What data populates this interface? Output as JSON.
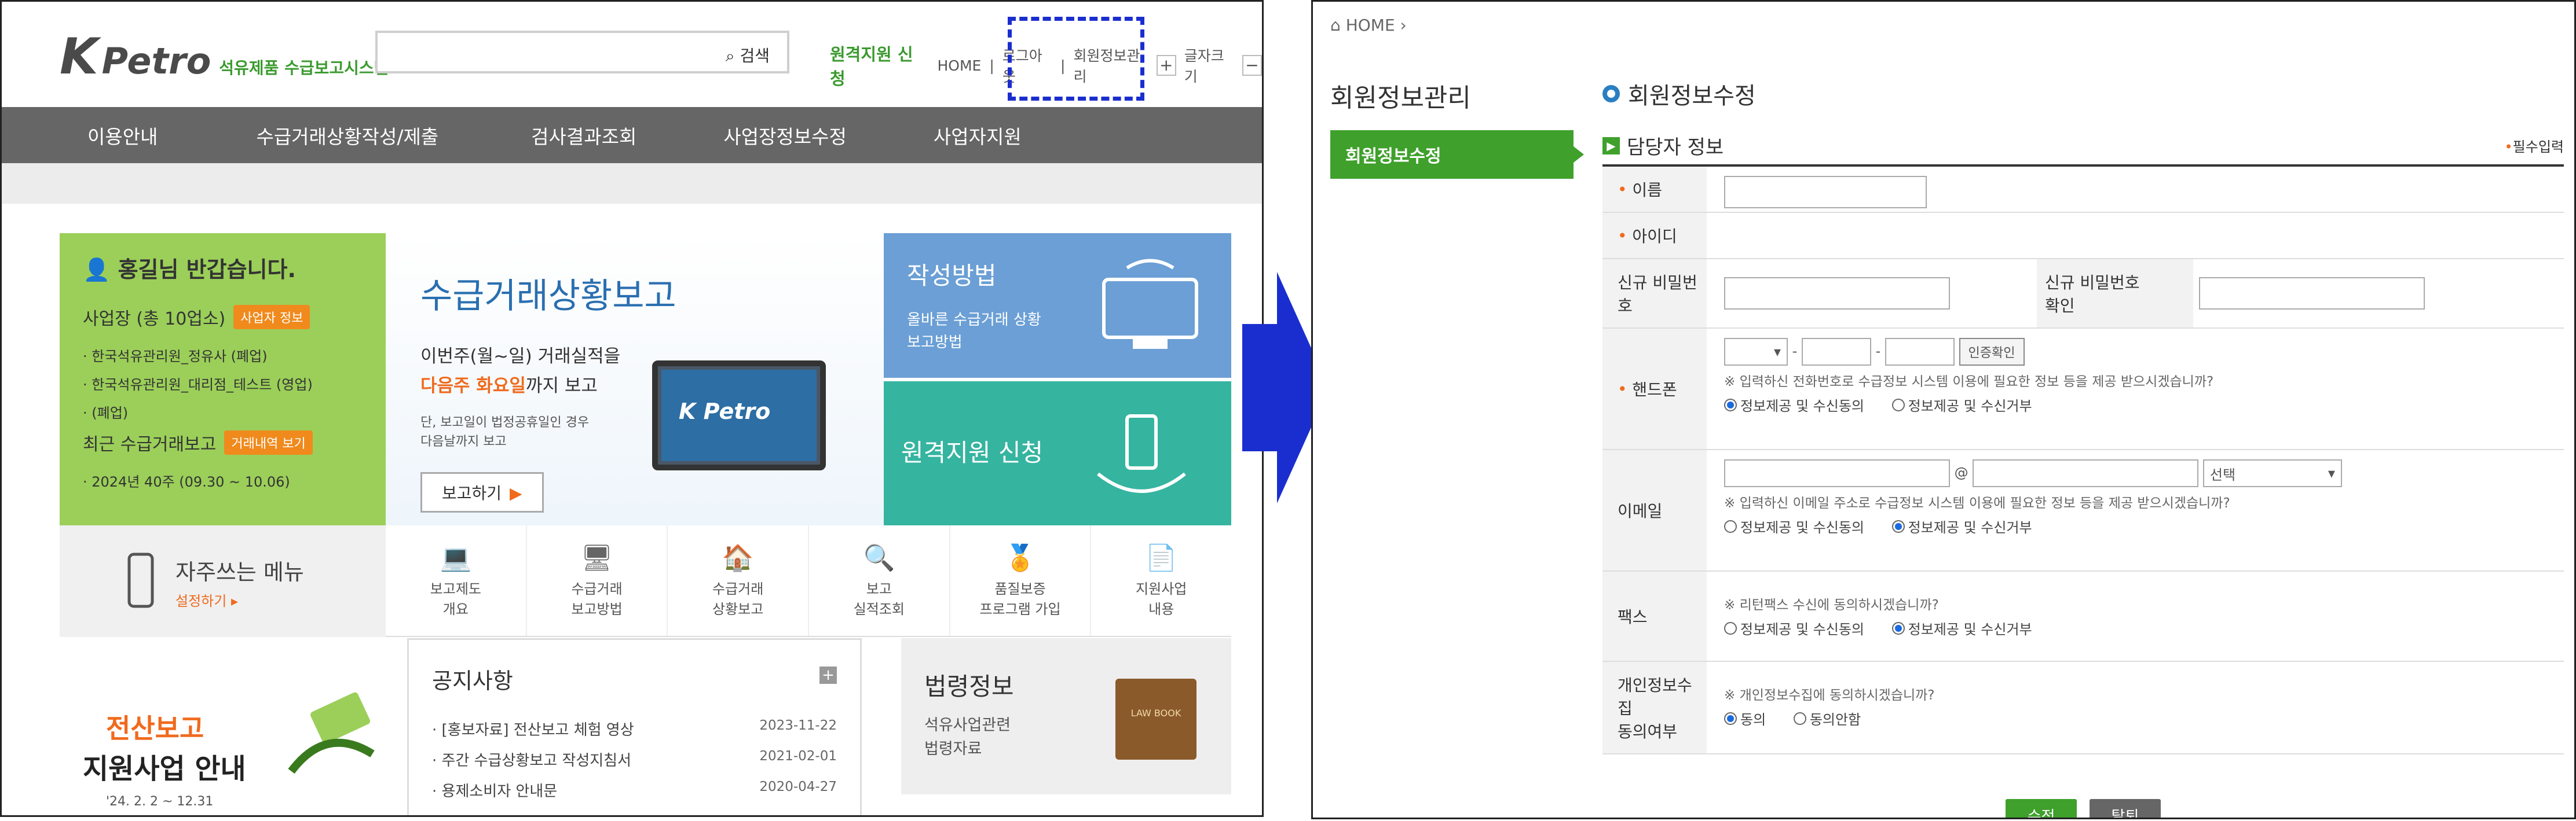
{
  "left": {
    "logo": {
      "brand_k": "K",
      "brand_petro": "Petro",
      "subtitle": "석유제품 수급보고시스템"
    },
    "search": {
      "button": "검색"
    },
    "toplinks": {
      "remote": "원격지원 신청",
      "home": "HOME",
      "logout": "로그아웃",
      "member": "회원정보관리",
      "plus": "+",
      "fontsize": "글자크기",
      "minus": "−"
    },
    "nav": [
      "이용안내",
      "수급거래상황작성/제출",
      "검사결과조회",
      "사업장정보수정",
      "사업자지원"
    ],
    "welcome": {
      "greeting": "홍길님 반갑습니다.",
      "sites": "사업장 (총 10업소)",
      "sites_tag": "사업자 정보",
      "items": [
        "· 한국석유관리원_정유사 (폐업)",
        "· 한국석유관리원_대리점_테스트 (영업)",
        "· (폐업)"
      ],
      "recent": "최근 수급거래보고",
      "recent_tag": "거래내역 보기",
      "period": "· 2024년 40주 (09.30 ~ 10.06)"
    },
    "banner": {
      "title": "수급거래상황보고",
      "line1": "이번주(월~일) 거래실적을",
      "line2_hl": "다음주 화요일",
      "line2_rest": "까지 보고",
      "line3a": "단, 보고일이 법정공휴일인 경우",
      "line3b": "다음날까지 보고",
      "button": "보고하기",
      "screen": "K Petro"
    },
    "how": {
      "title": "작성방법",
      "line1": "올바른 수급거래 상황",
      "line2": "보고방법"
    },
    "remote": {
      "title": "원격지원 신청"
    },
    "quick": {
      "title": "자주쓰는 메뉴",
      "setting": "설정하기"
    },
    "quick_icons": [
      {
        "icon": "laptop-icon",
        "l1": "보고제도",
        "l2": "개요"
      },
      {
        "icon": "monitor-edit-icon",
        "l1": "수급거래",
        "l2": "보고방법"
      },
      {
        "icon": "house-doc-icon",
        "l1": "수급거래",
        "l2": "상황보고"
      },
      {
        "icon": "magnifier-icon",
        "l1": "보고",
        "l2": "실적조회"
      },
      {
        "icon": "medal-icon",
        "l1": "품질보증",
        "l2": "프로그램 가입"
      },
      {
        "icon": "document-icon",
        "l1": "지원사업",
        "l2": "내용"
      }
    ],
    "support": {
      "a": "전산보고",
      "b": "지원사업 안내",
      "c": "'24. 2. 2 ~ 12.31"
    },
    "notice": {
      "title": "공지사항",
      "items": [
        {
          "t": "· [홍보자료] 전산보고 체험 영상",
          "d": "2023-11-22"
        },
        {
          "t": "· 주간 수급상황보고 작성지침서",
          "d": "2021-02-01"
        },
        {
          "t": "· 용제소비자 안내문",
          "d": "2020-04-27"
        }
      ]
    },
    "law": {
      "title": "법령정보",
      "l1": "석유사업관련",
      "l2": "법령자료",
      "book": "LAW BOOK"
    }
  },
  "right": {
    "home": "HOME",
    "title": "회원정보관리",
    "menu": "회원정보수정",
    "form_title": "회원정보수정",
    "section": "담당자 정보",
    "required": "필수입력",
    "labels": {
      "name": "이름",
      "id": "아이디",
      "newpw": "신규 비밀번호",
      "newpw2a": "신규 비밀번호",
      "newpw2b": "확인",
      "phone": "핸드폰",
      "email": "이메일",
      "fax": "팩스",
      "privacy_a": "개인정보수집",
      "privacy_b": "동의여부"
    },
    "phone": {
      "verify": "인증확인",
      "dash": "-",
      "note": "※ 입력하신 전화번호로 수급정보 시스템 이용에 필요한 정보 등을 제공 받으시겠습니까?",
      "opt_yes": "정보제공 및 수신동의",
      "opt_no": "정보제공 및 수신거부"
    },
    "email": {
      "at": "@",
      "select": "선택",
      "note": "※ 입력하신 이메일 주소로 수급정보 시스템 이용에 필요한 정보 등을 제공 받으시겠습니까?",
      "opt_yes": "정보제공 및 수신동의",
      "opt_no": "정보제공 및 수신거부"
    },
    "fax": {
      "note": "※ 리턴팩스 수신에 동의하시겠습니까?",
      "opt_yes": "정보제공 및 수신동의",
      "opt_no": "정보제공 및 수신거부"
    },
    "privacy": {
      "note": "※ 개인정보수집에 동의하시겠습니까?",
      "opt_yes": "동의",
      "opt_no": "동의안함"
    },
    "buttons": {
      "save": "수정",
      "withdraw": "탈퇴"
    }
  },
  "colors": {
    "green": "#3fa02c",
    "orange": "#f06a1d",
    "blue_arrow": "#1a2ecf",
    "nav": "#666666"
  }
}
